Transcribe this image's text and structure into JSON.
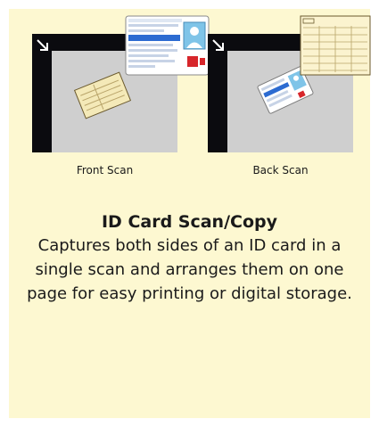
{
  "panels": {
    "front_caption": "Front Scan",
    "back_caption": "Back Scan"
  },
  "feature": {
    "title": "ID Card Scan/Copy",
    "description": "Captures both sides of an ID card in a single scan and arranges them on one page for easy printing or digital storage."
  },
  "colors": {
    "background": "#fdf8d1",
    "scanner_frame": "#0b0b0f",
    "scanner_bed": "#cfcfcf"
  },
  "icons": {
    "corner_arrow": "arrow-down-right-icon",
    "id_card": "id-card-icon",
    "card_back": "card-back-icon",
    "scanned_page": "scanned-page-icon"
  }
}
